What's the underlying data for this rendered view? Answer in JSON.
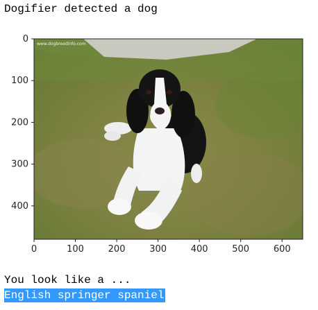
{
  "output": {
    "line1": "Dogifier detected a dog",
    "line2": "You look like a ...",
    "line3": "English springer spaniel"
  },
  "chart_data": {
    "type": "image",
    "title": "",
    "xlabel": "",
    "ylabel": "",
    "xlim": [
      0,
      650
    ],
    "ylim": [
      480,
      0
    ],
    "x_ticks": [
      "0",
      "100",
      "200",
      "300",
      "400",
      "500",
      "600"
    ],
    "y_ticks": [
      "0",
      "100",
      "200",
      "300",
      "400"
    ],
    "watermark": "www.dogbreedinfo.com",
    "grid": false
  }
}
